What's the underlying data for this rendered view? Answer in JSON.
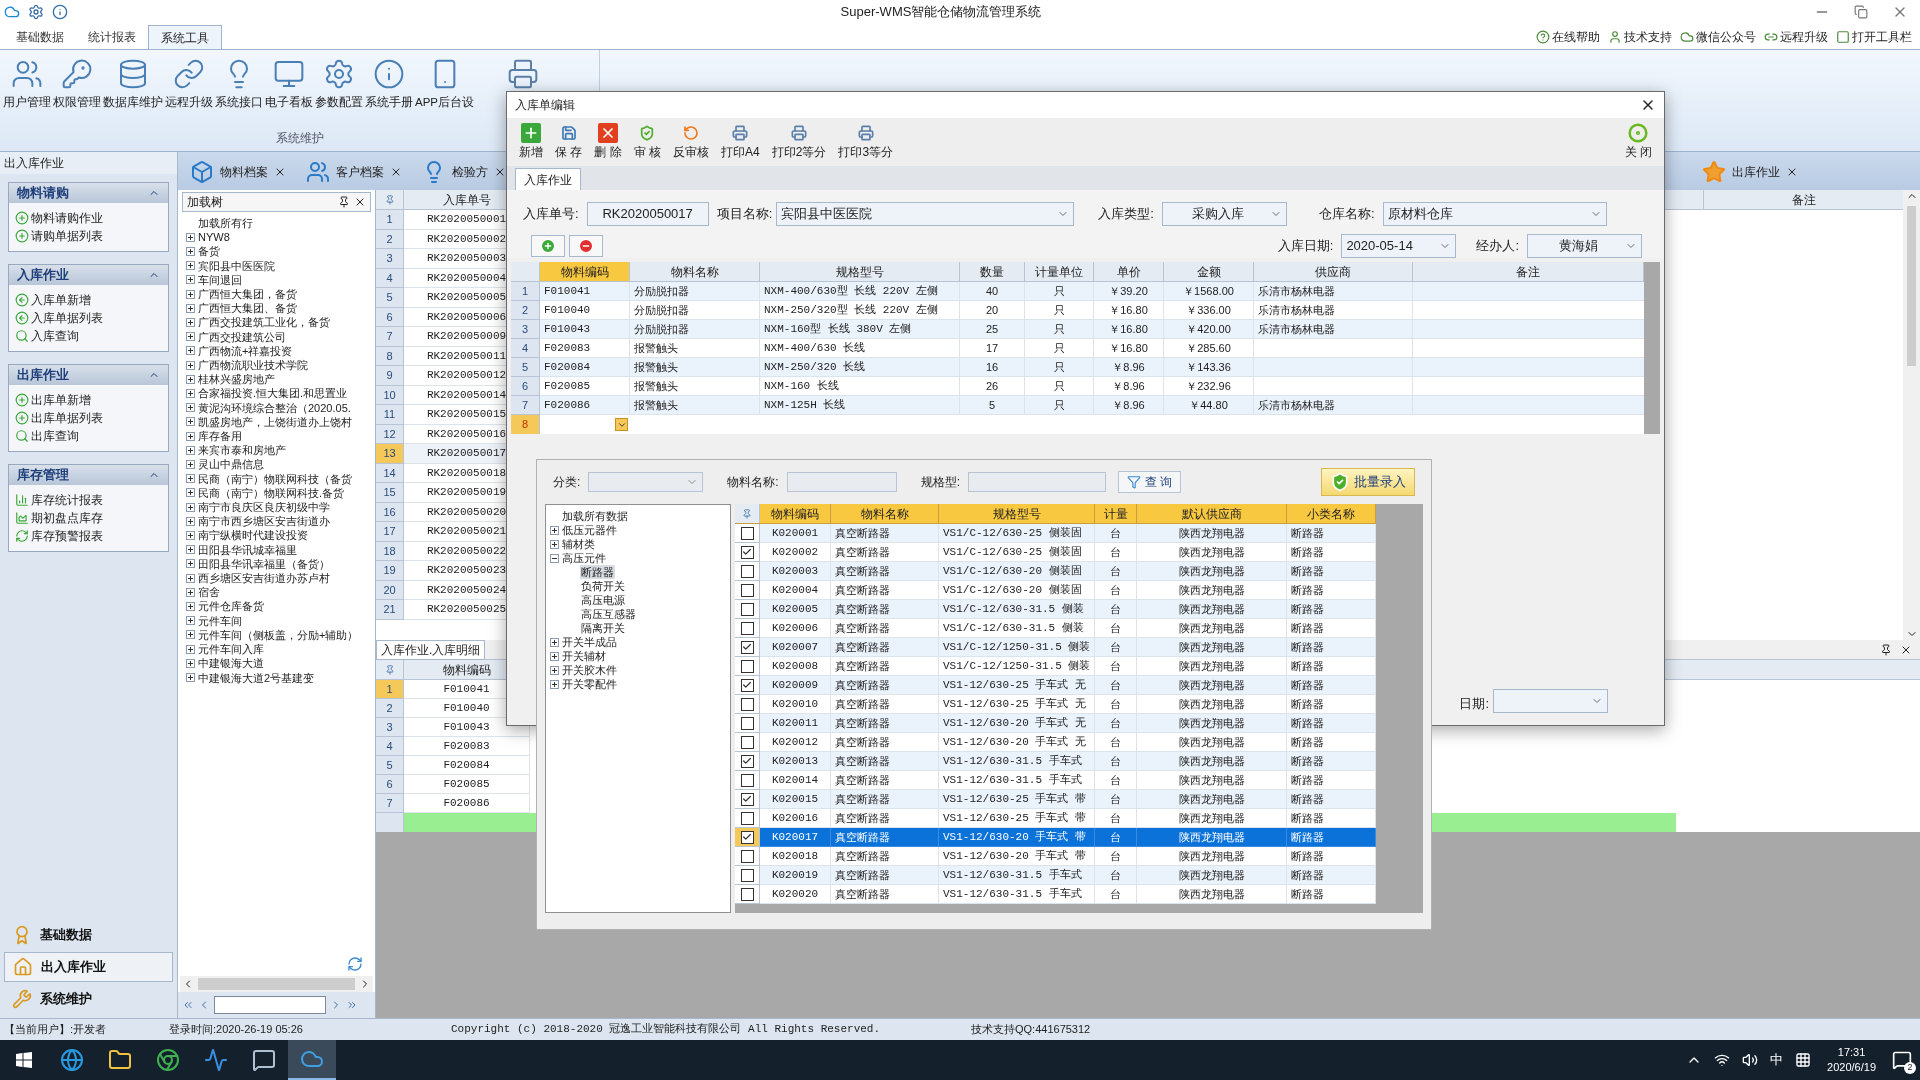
{
  "window": {
    "title": "Super-WMS智能仓储物流管理系统"
  },
  "ribbon_tabs": [
    {
      "label": "基础数据",
      "selected": false
    },
    {
      "label": "统计报表",
      "selected": false
    },
    {
      "label": "系统工具",
      "selected": true
    }
  ],
  "help_links": [
    "在线帮助",
    "技术支持",
    "微信公众号",
    "远程升级",
    "打开工具栏"
  ],
  "ribbon_buttons": [
    "用户管理",
    "权限管理",
    "数据库维护",
    "远程升级",
    "系统接口",
    "电子看板",
    "参数配置",
    "系统手册",
    "APP后台设"
  ],
  "ribbon_group": "系统维护",
  "nav": {
    "title": "出入库作业",
    "groups": [
      {
        "title": "物料请购",
        "expanded": true,
        "items": [
          "物料请购作业",
          "请购单据列表"
        ]
      },
      {
        "title": "入库作业",
        "expanded": true,
        "items": [
          "入库单新增",
          "入库单据列表",
          "入库查询"
        ]
      },
      {
        "title": "出库作业",
        "expanded": true,
        "items": [
          "出库单新增",
          "出库单据列表",
          "出库查询"
        ]
      },
      {
        "title": "库存管理",
        "expanded": true,
        "items": [
          "库存统计报表",
          "期初盘点库存",
          "库存预警报表"
        ]
      }
    ],
    "sections": [
      {
        "label": "基础数据",
        "selected": false
      },
      {
        "label": "出入库作业",
        "selected": true
      },
      {
        "label": "系统维护",
        "selected": false
      }
    ]
  },
  "doc_tabs": [
    "物料档案",
    "客户档案",
    "检验方"
  ],
  "right_tab": "出库作业",
  "tree": {
    "title": "加载树",
    "root": "加载所有行",
    "items": [
      {
        "label": "NYW8",
        "expanded": false
      },
      {
        "label": "备货",
        "expanded": false
      },
      {
        "label": "宾阳县中医医院",
        "expanded": false
      },
      {
        "label": "车间退回",
        "expanded": false
      },
      {
        "label": "广西恒大集团，备货",
        "expanded": false
      },
      {
        "label": "广西恒大集团、备货",
        "expanded": false
      },
      {
        "label": "广西交投建筑工业化，备货",
        "expanded": false
      },
      {
        "label": "广西交投建筑公司",
        "expanded": false
      },
      {
        "label": "广西物流+祥嘉投资",
        "expanded": false
      },
      {
        "label": "广西物流职业技术学院",
        "expanded": false
      },
      {
        "label": "桂林兴盛房地产",
        "expanded": false
      },
      {
        "label": "合家福投资.恒大集团.和思置业",
        "expanded": false
      },
      {
        "label": "黄泥沟环境综合整治（2020.05.",
        "expanded": false
      },
      {
        "label": "凯盛房地产，上饶街道办上饶村",
        "expanded": false
      },
      {
        "label": "库存备用",
        "expanded": false
      },
      {
        "label": "来宾市泰和房地产",
        "expanded": false
      },
      {
        "label": "灵山中鼎信息",
        "expanded": false
      },
      {
        "label": "民商（南宁）物联网科技（备货",
        "expanded": false
      },
      {
        "label": "民商（南宁）物联网科技.备货",
        "expanded": false
      },
      {
        "label": "南宁市良庆区良庆初级中学",
        "expanded": false
      },
      {
        "label": "南宁市西乡塘区安吉街道办",
        "expanded": false
      },
      {
        "label": "南宁纵横时代建设投资",
        "expanded": false
      },
      {
        "label": "田阳县华讯城幸福里",
        "expanded": false
      },
      {
        "label": "田阳县华讯幸福里（备货）",
        "expanded": false
      },
      {
        "label": "西乡塘区安吉街道办苏卢村",
        "expanded": false
      },
      {
        "label": "宿舍",
        "expanded": false
      },
      {
        "label": "元件仓库备货",
        "expanded": false
      },
      {
        "label": "元件车间",
        "expanded": false
      },
      {
        "label": "元件车间（侧板盖，分励+辅助）",
        "expanded": false
      },
      {
        "label": "元件车间入库",
        "expanded": false
      },
      {
        "label": "中建银海大道",
        "expanded": false
      },
      {
        "label": "中建银海大道2号基建变",
        "expanded": false
      }
    ]
  },
  "list_grid": {
    "column": "入库单号",
    "remark_column": "备注",
    "rows": [
      {
        "num": "1",
        "value": "RK2020050001",
        "selected": false
      },
      {
        "num": "2",
        "value": "RK2020050002",
        "selected": false
      },
      {
        "num": "3",
        "value": "RK2020050003",
        "selected": false
      },
      {
        "num": "4",
        "value": "RK2020050004",
        "selected": false
      },
      {
        "num": "5",
        "value": "RK2020050005",
        "selected": false
      },
      {
        "num": "6",
        "value": "RK2020050006",
        "selected": false
      },
      {
        "num": "7",
        "value": "RK2020050009",
        "selected": false
      },
      {
        "num": "8",
        "value": "RK2020050011",
        "selected": false
      },
      {
        "num": "9",
        "value": "RK2020050012",
        "selected": false
      },
      {
        "num": "10",
        "value": "RK2020050014",
        "selected": false
      },
      {
        "num": "11",
        "value": "RK2020050015",
        "selected": false
      },
      {
        "num": "12",
        "value": "RK2020050016",
        "selected": false
      },
      {
        "num": "13",
        "value": "RK2020050017",
        "selected": true
      },
      {
        "num": "14",
        "value": "RK2020050018",
        "selected": false
      },
      {
        "num": "15",
        "value": "RK2020050019",
        "selected": false
      },
      {
        "num": "16",
        "value": "RK2020050020",
        "selected": false
      },
      {
        "num": "17",
        "value": "RK2020050021",
        "selected": false
      },
      {
        "num": "18",
        "value": "RK2020050022",
        "selected": false
      },
      {
        "num": "19",
        "value": "RK2020050023",
        "selected": false
      },
      {
        "num": "20",
        "value": "RK2020050024",
        "selected": false
      },
      {
        "num": "21",
        "value": "RK2020050025",
        "selected": false
      }
    ]
  },
  "detail": {
    "tab": "入库作业.入库明细",
    "column": "物料编码",
    "rows": [
      {
        "num": "1",
        "value": "F010041",
        "selected": true
      },
      {
        "num": "2",
        "value": "F010040",
        "selected": false
      },
      {
        "num": "3",
        "value": "F010043",
        "selected": false
      },
      {
        "num": "4",
        "value": "F020083",
        "selected": false
      },
      {
        "num": "5",
        "value": "F020084",
        "selected": false
      },
      {
        "num": "6",
        "value": "F020085",
        "selected": false
      },
      {
        "num": "7",
        "value": "F020086",
        "selected": false
      }
    ]
  },
  "dialog": {
    "title": "入库单编辑",
    "tools": [
      "新增",
      "保 存",
      "删 除",
      "审 核",
      "反审核",
      "打印A4",
      "打印2等分",
      "打印3等分"
    ],
    "close": "关 闭",
    "tab": "入库作业",
    "fields": {
      "order_no": {
        "label": "入库单号:",
        "value": "RK2020050017"
      },
      "project": {
        "label": "项目名称:",
        "value": "宾阳县中医医院"
      },
      "type": {
        "label": "入库类型:",
        "value": "采购入库"
      },
      "warehouse": {
        "label": "仓库名称:",
        "value": "原材料仓库"
      },
      "date": {
        "label": "入库日期:",
        "value": "2020-05-14"
      },
      "handler": {
        "label": "经办人:",
        "value": "黄海娟"
      }
    },
    "columns": [
      "物料编码",
      "物料名称",
      "规格型号",
      "数量",
      "计量单位",
      "单价",
      "金额",
      "供应商",
      "备注"
    ],
    "rows": [
      {
        "num": "1",
        "code": "F010041",
        "name": "分励脱扣器",
        "spec": "NXM-400/630型 长线 220V 左侧",
        "qty": "40",
        "unit": "只",
        "price": "￥39.20",
        "amount": "￥1568.00",
        "supplier": "乐清市杨林电器"
      },
      {
        "num": "2",
        "code": "F010040",
        "name": "分励脱扣器",
        "spec": "NXM-250/320型 长线 220V 左侧",
        "qty": "20",
        "unit": "只",
        "price": "￥16.80",
        "amount": "￥336.00",
        "supplier": "乐清市杨林电器"
      },
      {
        "num": "3",
        "code": "F010043",
        "name": "分励脱扣器",
        "spec": "NXM-160型 长线 380V 左侧",
        "qty": "25",
        "unit": "只",
        "price": "￥16.80",
        "amount": "￥420.00",
        "supplier": "乐清市杨林电器"
      },
      {
        "num": "4",
        "code": "F020083",
        "name": "报警触头",
        "spec": "NXM-400/630 长线",
        "qty": "17",
        "unit": "只",
        "price": "￥16.80",
        "amount": "￥285.60"
      },
      {
        "num": "5",
        "code": "F020084",
        "name": "报警触头",
        "spec": "NXM-250/320 长线",
        "qty": "16",
        "unit": "只",
        "price": "￥8.96",
        "amount": "￥143.36"
      },
      {
        "num": "6",
        "code": "F020085",
        "name": "报警触头",
        "spec": "NXM-160 长线",
        "qty": "26",
        "unit": "只",
        "price": "￥8.96",
        "amount": "￥232.96"
      },
      {
        "num": "7",
        "code": "F020086",
        "name": "报警触头",
        "spec": "NXM-125H 长线",
        "qty": "5",
        "unit": "只",
        "price": "￥8.96",
        "amount": "￥44.80",
        "supplier": "乐清市杨林电器"
      }
    ],
    "new_row": "8",
    "behind_label": "日期:"
  },
  "batch": {
    "filters": [
      "分类:",
      "物料名称:",
      "规格型:"
    ],
    "query": "查 询",
    "batch_button": "批量录入",
    "tree": {
      "root": "加载所有数据",
      "items": [
        {
          "label": "低压元器件",
          "expanded": false
        },
        {
          "label": "辅材类",
          "expanded": false
        },
        {
          "label": "高压元件",
          "expanded": true,
          "children": [
            {
              "label": "断路器",
              "selected": true
            },
            {
              "label": "负荷开关",
              "selected": false
            },
            {
              "label": "高压电源",
              "selected": false
            },
            {
              "label": "高压互感器",
              "selected": false
            },
            {
              "label": "隔离开关",
              "selected": false
            }
          ]
        },
        {
          "label": "开关半成品",
          "expanded": false
        },
        {
          "label": "开关辅材",
          "expanded": false
        },
        {
          "label": "开关胶木件",
          "expanded": false
        },
        {
          "label": "开关零配件",
          "expanded": false
        }
      ]
    },
    "columns": [
      "物料编码",
      "物料名称",
      "规格型号",
      "计量",
      "默认供应商",
      "小类名称"
    ],
    "rows": [
      {
        "code": "K020001",
        "name": "真空断路器",
        "spec": "VS1/C-12/630-25 侧装固",
        "unit": "台",
        "supplier": "陕西龙翔电器",
        "category": "断路器",
        "checked": false,
        "selected": false
      },
      {
        "code": "K020002",
        "name": "真空断路器",
        "spec": "VS1/C-12/630-25 侧装固",
        "unit": "台",
        "supplier": "陕西龙翔电器",
        "category": "断路器",
        "checked": true,
        "selected": false
      },
      {
        "code": "K020003",
        "name": "真空断路器",
        "spec": "VS1/C-12/630-20 侧装固",
        "unit": "台",
        "supplier": "陕西龙翔电器",
        "category": "断路器",
        "checked": false,
        "selected": false
      },
      {
        "code": "K020004",
        "name": "真空断路器",
        "spec": "VS1/C-12/630-20 侧装固",
        "unit": "台",
        "supplier": "陕西龙翔电器",
        "category": "断路器",
        "checked": false,
        "selected": false
      },
      {
        "code": "K020005",
        "name": "真空断路器",
        "spec": "VS1/C-12/630-31.5 侧装",
        "unit": "台",
        "supplier": "陕西龙翔电器",
        "category": "断路器",
        "checked": false,
        "selected": false
      },
      {
        "code": "K020006",
        "name": "真空断路器",
        "spec": "VS1/C-12/630-31.5 侧装",
        "unit": "台",
        "supplier": "陕西龙翔电器",
        "category": "断路器",
        "checked": false,
        "selected": false
      },
      {
        "code": "K020007",
        "name": "真空断路器",
        "spec": "VS1/C-12/1250-31.5 侧装",
        "unit": "台",
        "supplier": "陕西龙翔电器",
        "category": "断路器",
        "checked": true,
        "selected": false
      },
      {
        "code": "K020008",
        "name": "真空断路器",
        "spec": "VS1/C-12/1250-31.5 侧装",
        "unit": "台",
        "supplier": "陕西龙翔电器",
        "category": "断路器",
        "checked": false,
        "selected": false
      },
      {
        "code": "K020009",
        "name": "真空断路器",
        "spec": "VS1-12/630-25 手车式 无",
        "unit": "台",
        "supplier": "陕西龙翔电器",
        "category": "断路器",
        "checked": true,
        "selected": false
      },
      {
        "code": "K020010",
        "name": "真空断路器",
        "spec": "VS1-12/630-25 手车式 无",
        "unit": "台",
        "supplier": "陕西龙翔电器",
        "category": "断路器",
        "checked": false,
        "selected": false
      },
      {
        "code": "K020011",
        "name": "真空断路器",
        "spec": "VS1-12/630-20 手车式 无",
        "unit": "台",
        "supplier": "陕西龙翔电器",
        "category": "断路器",
        "checked": false,
        "selected": false
      },
      {
        "code": "K020012",
        "name": "真空断路器",
        "spec": "VS1-12/630-20 手车式 无",
        "unit": "台",
        "supplier": "陕西龙翔电器",
        "category": "断路器",
        "checked": false,
        "selected": false
      },
      {
        "code": "K020013",
        "name": "真空断路器",
        "spec": "VS1-12/630-31.5 手车式",
        "unit": "台",
        "supplier": "陕西龙翔电器",
        "category": "断路器",
        "checked": true,
        "selected": false
      },
      {
        "code": "K020014",
        "name": "真空断路器",
        "spec": "VS1-12/630-31.5 手车式",
        "unit": "台",
        "supplier": "陕西龙翔电器",
        "category": "断路器",
        "checked": false,
        "selected": false
      },
      {
        "code": "K020015",
        "name": "真空断路器",
        "spec": "VS1-12/630-25 手车式 带",
        "unit": "台",
        "supplier": "陕西龙翔电器",
        "category": "断路器",
        "checked": true,
        "selected": false
      },
      {
        "code": "K020016",
        "name": "真空断路器",
        "spec": "VS1-12/630-25 手车式 带",
        "unit": "台",
        "supplier": "陕西龙翔电器",
        "category": "断路器",
        "checked": false,
        "selected": false
      },
      {
        "code": "K020017",
        "name": "真空断路器",
        "spec": "VS1-12/630-20 手车式 带",
        "unit": "台",
        "supplier": "陕西龙翔电器",
        "category": "断路器",
        "checked": true,
        "selected": true
      },
      {
        "code": "K020018",
        "name": "真空断路器",
        "spec": "VS1-12/630-20 手车式 带",
        "unit": "台",
        "supplier": "陕西龙翔电器",
        "category": "断路器",
        "checked": false,
        "selected": false
      },
      {
        "code": "K020019",
        "name": "真空断路器",
        "spec": "VS1-12/630-31.5 手车式",
        "unit": "台",
        "supplier": "陕西龙翔电器",
        "category": "断路器",
        "checked": false,
        "selected": false
      },
      {
        "code": "K020020",
        "name": "真空断路器",
        "spec": "VS1-12/630-31.5 手车式",
        "unit": "台",
        "supplier": "陕西龙翔电器",
        "category": "断路器",
        "checked": false,
        "selected": false
      }
    ]
  },
  "status_bar": [
    "【当前用户】:开发者",
    "登录时间:2020-26-19 05:26",
    "Copyright (c) 2018-2020 冠逸工业智能科技有限公司 All Rights Reserved.",
    "技术支持QQ:441675312"
  ],
  "taskbar": {
    "ime": "中",
    "time": "17:31",
    "date": "2020/6/19",
    "notifications": "2"
  }
}
